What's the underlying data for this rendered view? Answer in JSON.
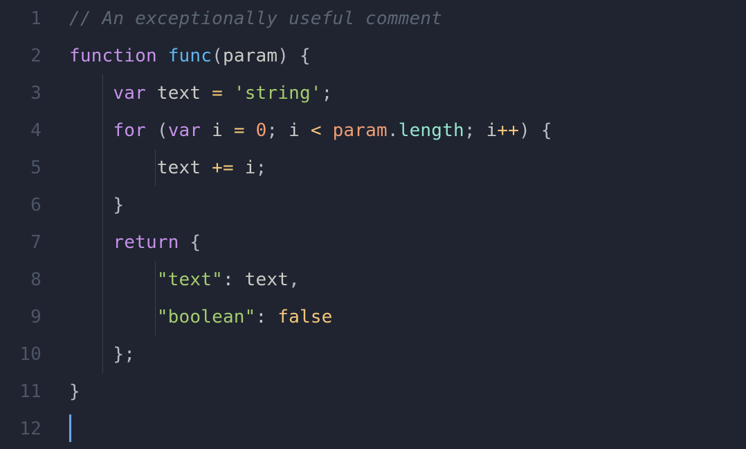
{
  "line_numbers": [
    "1",
    "2",
    "3",
    "4",
    "5",
    "6",
    "7",
    "8",
    "9",
    "10",
    "11",
    "12"
  ],
  "lines": [
    {
      "indent": 0,
      "guides": [],
      "tokens": [
        {
          "cls": "tok-comment",
          "t": "// An exceptionally useful comment"
        }
      ]
    },
    {
      "indent": 0,
      "guides": [],
      "tokens": [
        {
          "cls": "tok-keyword",
          "t": "function"
        },
        {
          "cls": "tok-default",
          "t": " "
        },
        {
          "cls": "tok-funcname",
          "t": "func"
        },
        {
          "cls": "tok-paren",
          "t": "("
        },
        {
          "cls": "tok-param",
          "t": "param"
        },
        {
          "cls": "tok-paren",
          "t": ")"
        },
        {
          "cls": "tok-default",
          "t": " "
        },
        {
          "cls": "tok-brace",
          "t": "{"
        }
      ]
    },
    {
      "indent": 4,
      "guides": [
        "g1"
      ],
      "tokens": [
        {
          "cls": "tok-keyword",
          "t": "var"
        },
        {
          "cls": "tok-default",
          "t": " "
        },
        {
          "cls": "tok-ident",
          "t": "text"
        },
        {
          "cls": "tok-default",
          "t": " "
        },
        {
          "cls": "tok-operator",
          "t": "="
        },
        {
          "cls": "tok-default",
          "t": " "
        },
        {
          "cls": "tok-string",
          "t": "'string'"
        },
        {
          "cls": "tok-semi",
          "t": ";"
        }
      ]
    },
    {
      "indent": 4,
      "guides": [
        "g1"
      ],
      "tokens": [
        {
          "cls": "tok-keyword",
          "t": "for"
        },
        {
          "cls": "tok-default",
          "t": " "
        },
        {
          "cls": "tok-paren",
          "t": "("
        },
        {
          "cls": "tok-keyword",
          "t": "var"
        },
        {
          "cls": "tok-default",
          "t": " "
        },
        {
          "cls": "tok-ident",
          "t": "i"
        },
        {
          "cls": "tok-default",
          "t": " "
        },
        {
          "cls": "tok-operator",
          "t": "="
        },
        {
          "cls": "tok-default",
          "t": " "
        },
        {
          "cls": "tok-number",
          "t": "0"
        },
        {
          "cls": "tok-semi",
          "t": ";"
        },
        {
          "cls": "tok-default",
          "t": " "
        },
        {
          "cls": "tok-ident",
          "t": "i"
        },
        {
          "cls": "tok-default",
          "t": " "
        },
        {
          "cls": "tok-operator",
          "t": "<"
        },
        {
          "cls": "tok-default",
          "t": " "
        },
        {
          "cls": "tok-property",
          "t": "param"
        },
        {
          "cls": "tok-dot",
          "t": "."
        },
        {
          "cls": "tok-method",
          "t": "length"
        },
        {
          "cls": "tok-semi",
          "t": ";"
        },
        {
          "cls": "tok-default",
          "t": " "
        },
        {
          "cls": "tok-ident",
          "t": "i"
        },
        {
          "cls": "tok-operator",
          "t": "++"
        },
        {
          "cls": "tok-paren",
          "t": ")"
        },
        {
          "cls": "tok-default",
          "t": " "
        },
        {
          "cls": "tok-brace",
          "t": "{"
        }
      ]
    },
    {
      "indent": 8,
      "guides": [
        "g1",
        "g2"
      ],
      "tokens": [
        {
          "cls": "tok-ident",
          "t": "text"
        },
        {
          "cls": "tok-default",
          "t": " "
        },
        {
          "cls": "tok-operator",
          "t": "+="
        },
        {
          "cls": "tok-default",
          "t": " "
        },
        {
          "cls": "tok-ident",
          "t": "i"
        },
        {
          "cls": "tok-semi",
          "t": ";"
        }
      ]
    },
    {
      "indent": 4,
      "guides": [
        "g1"
      ],
      "tokens": [
        {
          "cls": "tok-brace",
          "t": "}"
        }
      ]
    },
    {
      "indent": 4,
      "guides": [
        "g1"
      ],
      "tokens": [
        {
          "cls": "tok-keyword",
          "t": "return"
        },
        {
          "cls": "tok-default",
          "t": " "
        },
        {
          "cls": "tok-brace",
          "t": "{"
        }
      ]
    },
    {
      "indent": 8,
      "guides": [
        "g1",
        "g2"
      ],
      "tokens": [
        {
          "cls": "tok-key",
          "t": "\"text\""
        },
        {
          "cls": "tok-default",
          "t": ":"
        },
        {
          "cls": "tok-default",
          "t": " "
        },
        {
          "cls": "tok-ident",
          "t": "text"
        },
        {
          "cls": "tok-comma",
          "t": ","
        }
      ]
    },
    {
      "indent": 8,
      "guides": [
        "g1",
        "g2"
      ],
      "tokens": [
        {
          "cls": "tok-key",
          "t": "\"boolean\""
        },
        {
          "cls": "tok-default",
          "t": ":"
        },
        {
          "cls": "tok-default",
          "t": " "
        },
        {
          "cls": "tok-constant",
          "t": "false"
        }
      ]
    },
    {
      "indent": 4,
      "guides": [
        "g1"
      ],
      "tokens": [
        {
          "cls": "tok-brace",
          "t": "}"
        },
        {
          "cls": "tok-semi",
          "t": ";"
        }
      ]
    },
    {
      "indent": 0,
      "guides": [],
      "tokens": [
        {
          "cls": "tok-brace",
          "t": "}"
        }
      ]
    },
    {
      "indent": 0,
      "guides": [],
      "cursor": true,
      "tokens": []
    }
  ]
}
